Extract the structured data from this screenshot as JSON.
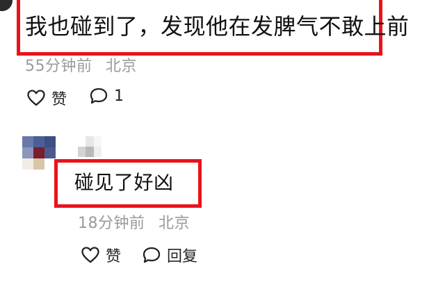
{
  "comment": {
    "text": "我也碰到了，发现他在发脾气不敢上前",
    "time": "55分钟前",
    "location": "北京",
    "like_label": "赞",
    "reply_count": "1"
  },
  "reply": {
    "text": "碰见了好凶",
    "time": "18分钟前",
    "location": "北京",
    "like_label": "赞",
    "reply_label": "回复"
  },
  "colors": {
    "highlight": "#e8131a",
    "meta_text": "#9a9a9a",
    "body_text": "#111111"
  },
  "icons": {
    "like": "heart-outline-icon",
    "comment": "speech-bubble-icon"
  }
}
